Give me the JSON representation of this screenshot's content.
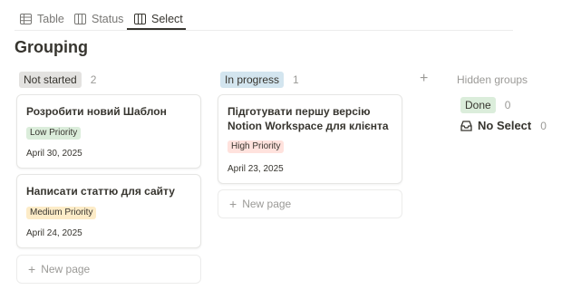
{
  "tabs": [
    {
      "label": "Table",
      "icon": "table-icon"
    },
    {
      "label": "Status",
      "icon": "board-icon"
    },
    {
      "label": "Select",
      "icon": "board-icon"
    }
  ],
  "page_title": "Grouping",
  "columns": [
    {
      "label": "Not started",
      "count": "2",
      "color": "#e3e2e0",
      "cards": [
        {
          "title": "Розробити новий Шаблон",
          "tag": "Low Priority",
          "date": "April 30, 2025"
        },
        {
          "title": "Написати статтю для сайту",
          "tag": "Medium Priority",
          "date": "April 24, 2025"
        }
      ],
      "new_page": "New page"
    },
    {
      "label": "In progress",
      "count": "1",
      "color": "#d3e5ef",
      "cards": [
        {
          "title": "Підготувати першу версію Notion Workspace для клієнта",
          "tag": "High Priority",
          "date": "April 23, 2025"
        }
      ],
      "new_page": "New page"
    }
  ],
  "tag_colors": {
    "low": "#dbeddb",
    "medium": "#fdecc8",
    "high": "#ffe2dd"
  },
  "add_group": "+",
  "hidden_groups": {
    "title": "Hidden groups",
    "items": [
      {
        "label": "Done",
        "count": "0",
        "color": "#dbeddb"
      },
      {
        "label": "No Select",
        "count": "0",
        "icon": "inbox-icon"
      }
    ]
  }
}
